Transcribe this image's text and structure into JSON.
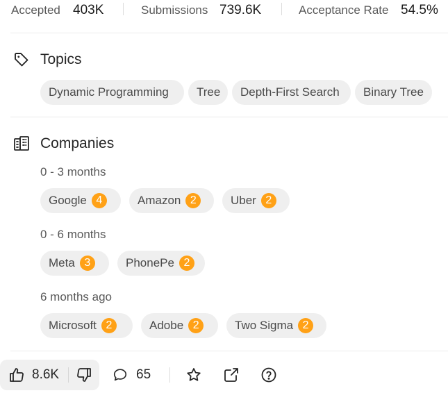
{
  "stats": {
    "accepted_label": "Accepted",
    "accepted_value": "403K",
    "submissions_label": "Submissions",
    "submissions_value": "739.6K",
    "acceptance_label": "Acceptance Rate",
    "acceptance_value": "54.5%"
  },
  "topics": {
    "title": "Topics",
    "icon": "tag-icon",
    "items": [
      "Dynamic Programming",
      "Tree",
      "Depth-First Search",
      "Binary Tree"
    ]
  },
  "companies": {
    "title": "Companies",
    "icon": "building-icon",
    "accent_color": "#ffa116",
    "groups": [
      {
        "period": "0 - 3 months",
        "items": [
          {
            "name": "Google",
            "count": "4"
          },
          {
            "name": "Amazon",
            "count": "2"
          },
          {
            "name": "Uber",
            "count": "2"
          }
        ]
      },
      {
        "period": "0 - 6 months",
        "items": [
          {
            "name": "Meta",
            "count": "3"
          },
          {
            "name": "PhonePe",
            "count": "2"
          }
        ]
      },
      {
        "period": "6 months ago",
        "items": [
          {
            "name": "Microsoft",
            "count": "2"
          },
          {
            "name": "Adobe",
            "count": "2"
          },
          {
            "name": "Two Sigma",
            "count": "2"
          }
        ]
      }
    ]
  },
  "footer": {
    "likes": "8.6K",
    "comments": "65",
    "icons": [
      "thumbs-up-icon",
      "thumbs-down-icon",
      "comment-icon",
      "star-icon",
      "share-icon",
      "help-icon"
    ]
  }
}
